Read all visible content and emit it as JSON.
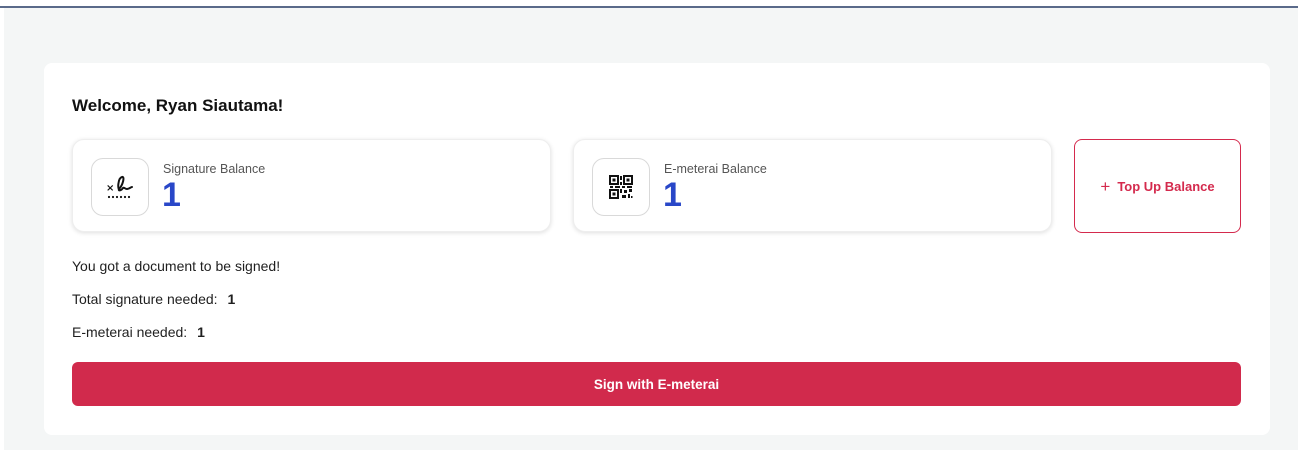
{
  "welcome": "Welcome, Ryan Siautama!",
  "signature": {
    "label": "Signature Balance",
    "value": "1",
    "icon": "signature-icon"
  },
  "emeterai": {
    "label": "E-meterai Balance",
    "value": "1",
    "icon": "qr-code-icon"
  },
  "topup": {
    "icon": "plus-icon",
    "label": "Top Up Balance"
  },
  "info": {
    "document_msg": "You got a document to be signed!",
    "total_signature_label": "Total signature needed:",
    "total_signature_value": "1",
    "emeterai_needed_label": "E-meterai needed:",
    "emeterai_needed_value": "1"
  },
  "sign_button": "Sign with E-meterai",
  "colors": {
    "accent": "#d12a4c",
    "balance_value": "#2947c8",
    "background": "#f4f6f6"
  }
}
